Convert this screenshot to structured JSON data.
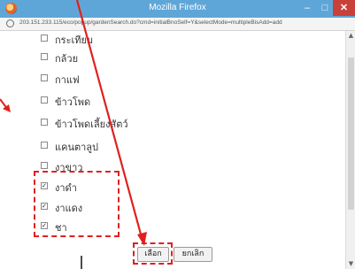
{
  "window": {
    "title": "Mozilla Firefox",
    "url": "203.151.233.115/eco/popup/gardenSearch.do?cmd=initialBnoSelf=Y&selectMode=multipleBisAdd=add",
    "buttons": {
      "minimize": "–",
      "maximize": "□",
      "close": "✕"
    }
  },
  "list": {
    "items": [
      {
        "label": "กระเทียม",
        "checked": false
      },
      {
        "label": "กล้วย",
        "checked": false
      },
      {
        "label": "กาแฟ",
        "checked": false
      },
      {
        "label": "ข้าวโพด",
        "checked": false
      },
      {
        "label": "ข้าวโพดเลี้ยงสัตว์",
        "checked": false
      },
      {
        "label": "แคนตาลูป",
        "checked": false
      },
      {
        "label": "งาขาว",
        "checked": false
      },
      {
        "label": "งาดำ",
        "checked": true
      },
      {
        "label": "งาแดง",
        "checked": true
      },
      {
        "label": "ชา",
        "checked": true
      }
    ]
  },
  "actions": {
    "select_label": "เลือก",
    "cancel_label": "ยกเลิก"
  },
  "scrollbar": {
    "up": "▲",
    "down": "▼"
  },
  "colors": {
    "titlebar": "#5fa6d8",
    "close_button": "#c9403a",
    "annotation": "#e02020"
  }
}
